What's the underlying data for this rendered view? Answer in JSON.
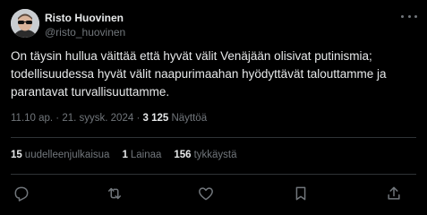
{
  "author": {
    "name": "Risto Huovinen",
    "handle": "@risto_huovinen"
  },
  "tweet": {
    "lines": [
      "On täysin hullua väittää että hyvät välit Venäjään olisivat putinismia;",
      "todellisuudessa hyvät välit naapurimaahan hyödyttävät talouttamme ja",
      "parantavat turvallisuuttamme."
    ]
  },
  "meta": {
    "time": "11.10 ap.",
    "separator": " · ",
    "date": "21. syysk. 2024",
    "separator2": " · ",
    "views_count": "3 125",
    "views_label": " Näyttöä"
  },
  "stats": {
    "retweets_count": "15",
    "retweets_label": "uudelleenjulkaisua",
    "quotes_count": "1",
    "quotes_label": "Lainaa",
    "likes_count": "156",
    "likes_label": "tykkäystä"
  },
  "icons": {
    "reply": "reply-icon",
    "retweet": "retweet-icon",
    "like": "heart-icon",
    "bookmark": "bookmark-icon",
    "share": "share-icon",
    "more": "more-icon"
  },
  "colors": {
    "background": "#000000",
    "text": "#e7e9ea",
    "muted": "#71767b",
    "divider": "#2f3336"
  }
}
